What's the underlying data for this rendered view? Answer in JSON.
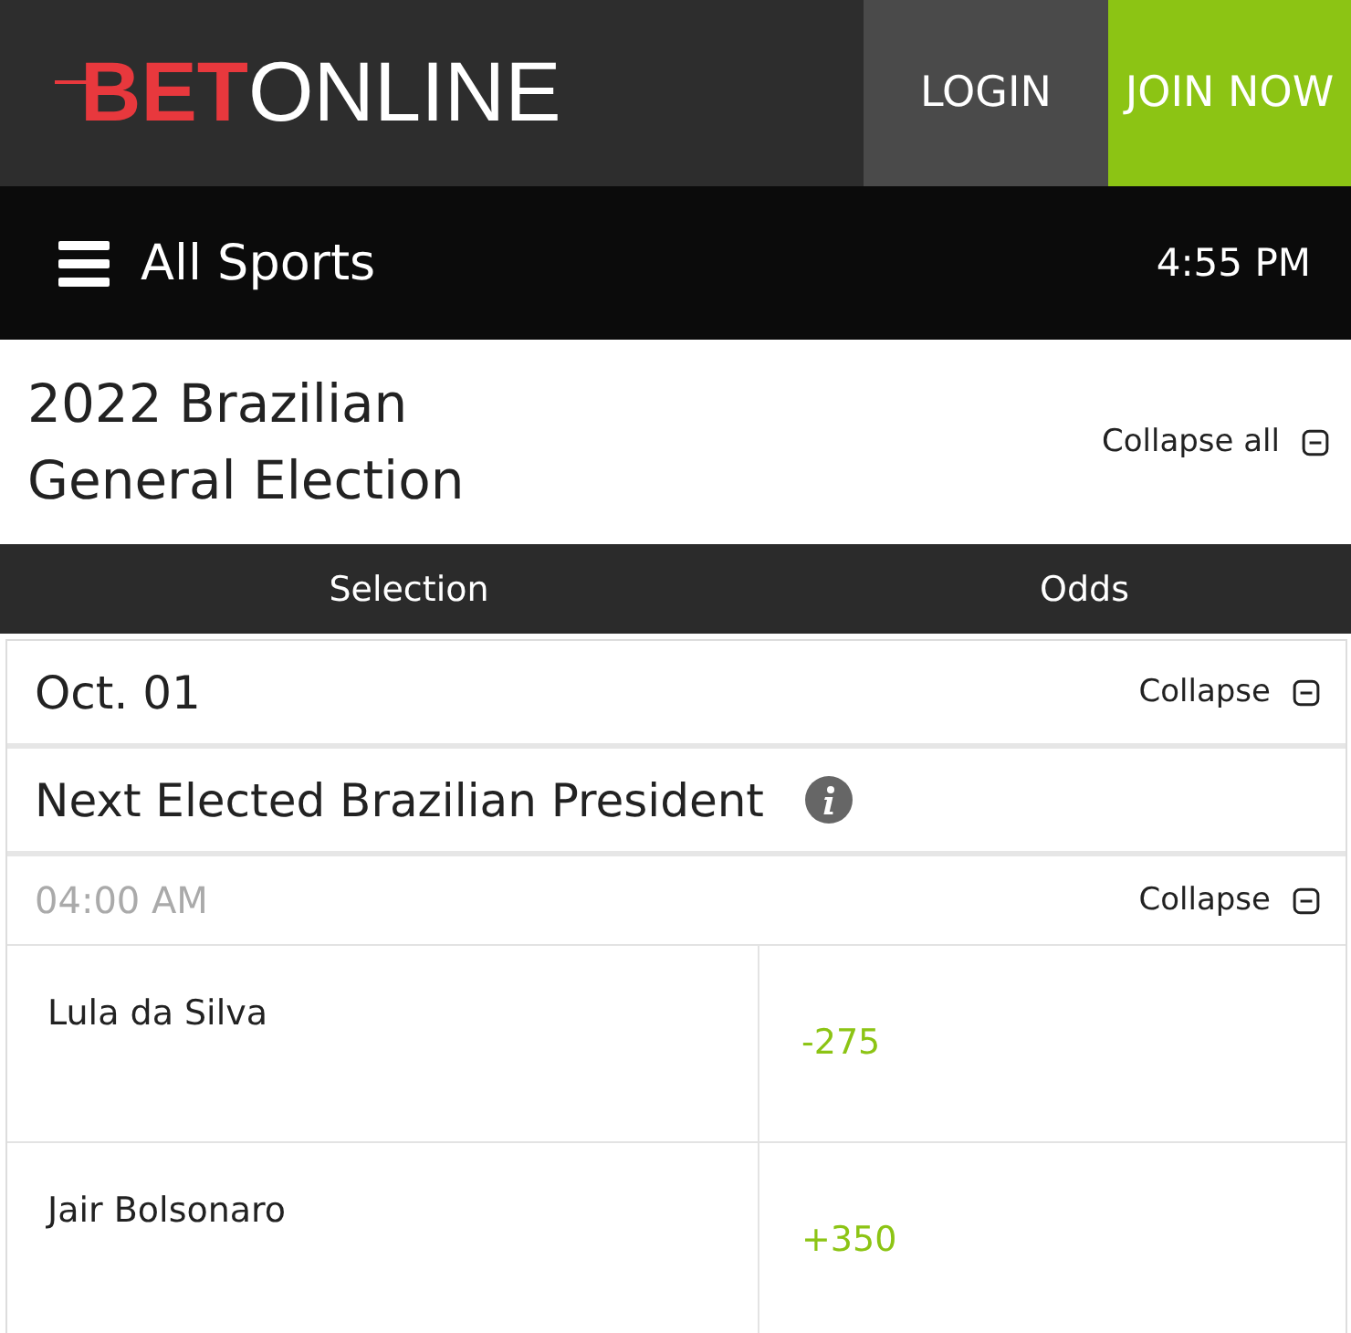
{
  "header": {
    "logo": {
      "accent": "BET",
      "rest": "ONLINE"
    },
    "buttons": [
      {
        "label": "LOGIN",
        "kind": "login"
      },
      {
        "label": "JOIN NOW",
        "kind": "join"
      }
    ]
  },
  "nav": {
    "label": "All Sports",
    "time": "4:55 PM"
  },
  "page_title": {
    "title": "2022 Brazilian General Election",
    "action": "Collapse all"
  },
  "table": {
    "columns": [
      "Selection",
      "Odds"
    ],
    "groups": [
      {
        "date": "Oct. 01",
        "action": "Collapse",
        "event": "Next Elected Brazilian President",
        "time": "04:00 AM",
        "time_action": "Collapse",
        "rows": [
          {
            "selection": "Lula da Silva",
            "odds": "-275"
          },
          {
            "selection": "Jair Bolsonaro",
            "odds": "+350"
          }
        ]
      }
    ]
  }
}
